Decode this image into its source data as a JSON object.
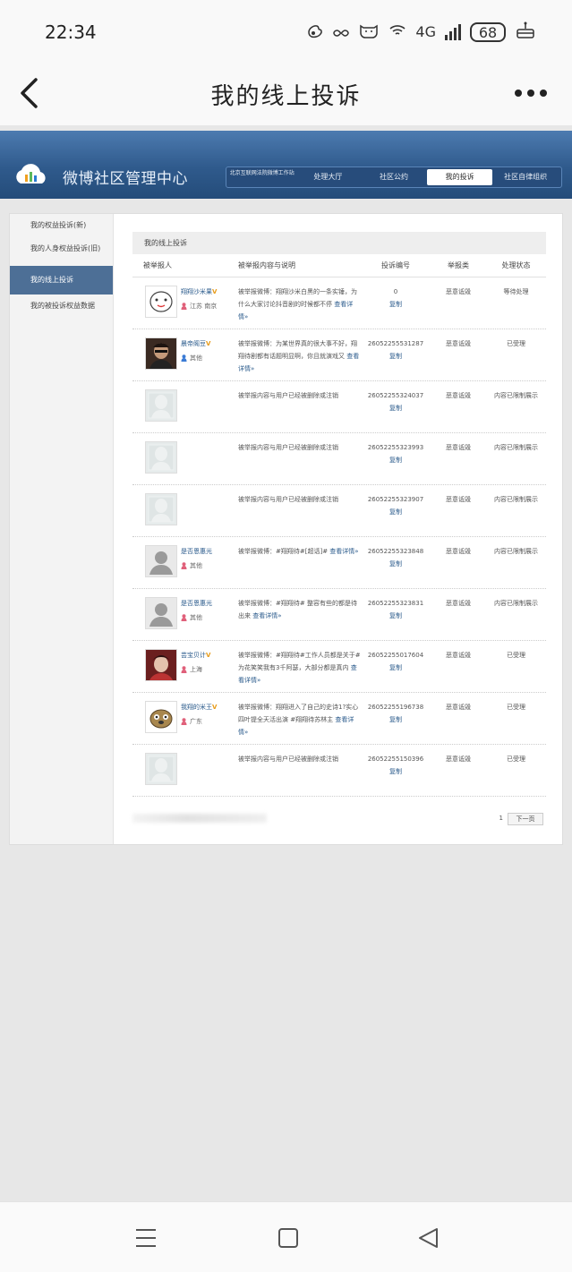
{
  "status_bar": {
    "time": "22:34",
    "network": "4G",
    "battery": "68",
    "icons": [
      "weibo-icon",
      "infinity-icon",
      "cat-icon",
      "wifi-icon",
      "signal-icon",
      "battery-icon",
      "cake-icon"
    ]
  },
  "app_header": {
    "title": "我的线上投诉"
  },
  "banner": {
    "brand": "微博社区管理中心",
    "nav": [
      {
        "label": "北京互联网法院微博工作站"
      },
      {
        "label": "处理大厅"
      },
      {
        "label": "社区公约"
      },
      {
        "label": "我的投诉"
      },
      {
        "label": "社区自律组织"
      }
    ]
  },
  "sidebar": {
    "items": [
      {
        "label": "我的权益投诉(新)"
      },
      {
        "label": "我的人身权益投诉(旧)"
      },
      {
        "label": "我的线上投诉"
      },
      {
        "label": "我的被投诉权益数据"
      }
    ]
  },
  "content": {
    "title": "我的线上投诉",
    "columns": {
      "user": "被举报人",
      "desc": "被举报内容与说明",
      "number": "投诉编号",
      "type": "举报类",
      "status": "处理状态"
    },
    "copy_label": "复制",
    "more_label": "查看详情»",
    "rows": [
      {
        "name": "翔翔沙米果",
        "v": "V",
        "location": "江苏 南京",
        "gender": "female",
        "desc": "被举报微博：翔翔沙米白黑的一条实锤，为什么大家讨论抖音剧的时候都不停",
        "number": "0",
        "type": "恶意诋毁",
        "status": "等待处理"
      },
      {
        "name": "晨帝阁豆",
        "v": "V",
        "location": "其他",
        "gender": "male",
        "desc": "被举报微博：为某世界真的很大事不好，翔翔待剧都有话题明显啊，你且就演戏又",
        "number": "26052255531287",
        "type": "恶意诋毁",
        "status": "已受理"
      },
      {
        "name": "",
        "v": "",
        "location": "",
        "gender": "",
        "desc": "被举报内容与用户已经被删除或注销",
        "number": "26052255324037",
        "type": "恶意诋毁",
        "status": "内容已限制展示"
      },
      {
        "name": "",
        "v": "",
        "location": "",
        "gender": "",
        "desc": "被举报内容与用户已经被删除或注销",
        "number": "26052255323993",
        "type": "恶意诋毁",
        "status": "内容已限制展示"
      },
      {
        "name": "",
        "v": "",
        "location": "",
        "gender": "",
        "desc": "被举报内容与用户已经被删除或注销",
        "number": "26052255323907",
        "type": "恶意诋毁",
        "status": "内容已限制展示"
      },
      {
        "name": "是否恩惠光",
        "v": "",
        "location": "其他",
        "gender": "female",
        "desc": "被举报微博：#翔翔待#[超话]#",
        "number": "26052255323848",
        "type": "恶意诋毁",
        "status": "内容已限制展示"
      },
      {
        "name": "是否恩惠光",
        "v": "",
        "location": "其他",
        "gender": "female",
        "desc": "被举报微博：#翔翔待# 整容有些的都是待出来",
        "number": "26052255323831",
        "type": "恶意诋毁",
        "status": "内容已限制展示"
      },
      {
        "name": "芸宝贝计",
        "v": "V",
        "location": "上海",
        "gender": "female",
        "desc": "被举报微博：#翔翔待#工作人员都是关于#为花笑笑我有3千阿瑟，大部分都是真内",
        "number": "26052255017604",
        "type": "恶意诋毁",
        "status": "已受理"
      },
      {
        "name": "我翔的米王",
        "v": "V",
        "location": "广东",
        "gender": "female",
        "desc": "被举报微博：翔翔进入了自己的史诗1?实心四叶提全天活出演 #翔翔待苏林主",
        "number": "26052255196738",
        "type": "恶意诋毁",
        "status": "已受理"
      },
      {
        "name": "",
        "v": "",
        "location": "",
        "gender": "",
        "desc": "被举报内容与用户已经被删除或注销",
        "number": "26052255150396",
        "type": "恶意诋毁",
        "status": "已受理"
      }
    ],
    "footer": {
      "page": "1",
      "next": "下一页"
    }
  }
}
